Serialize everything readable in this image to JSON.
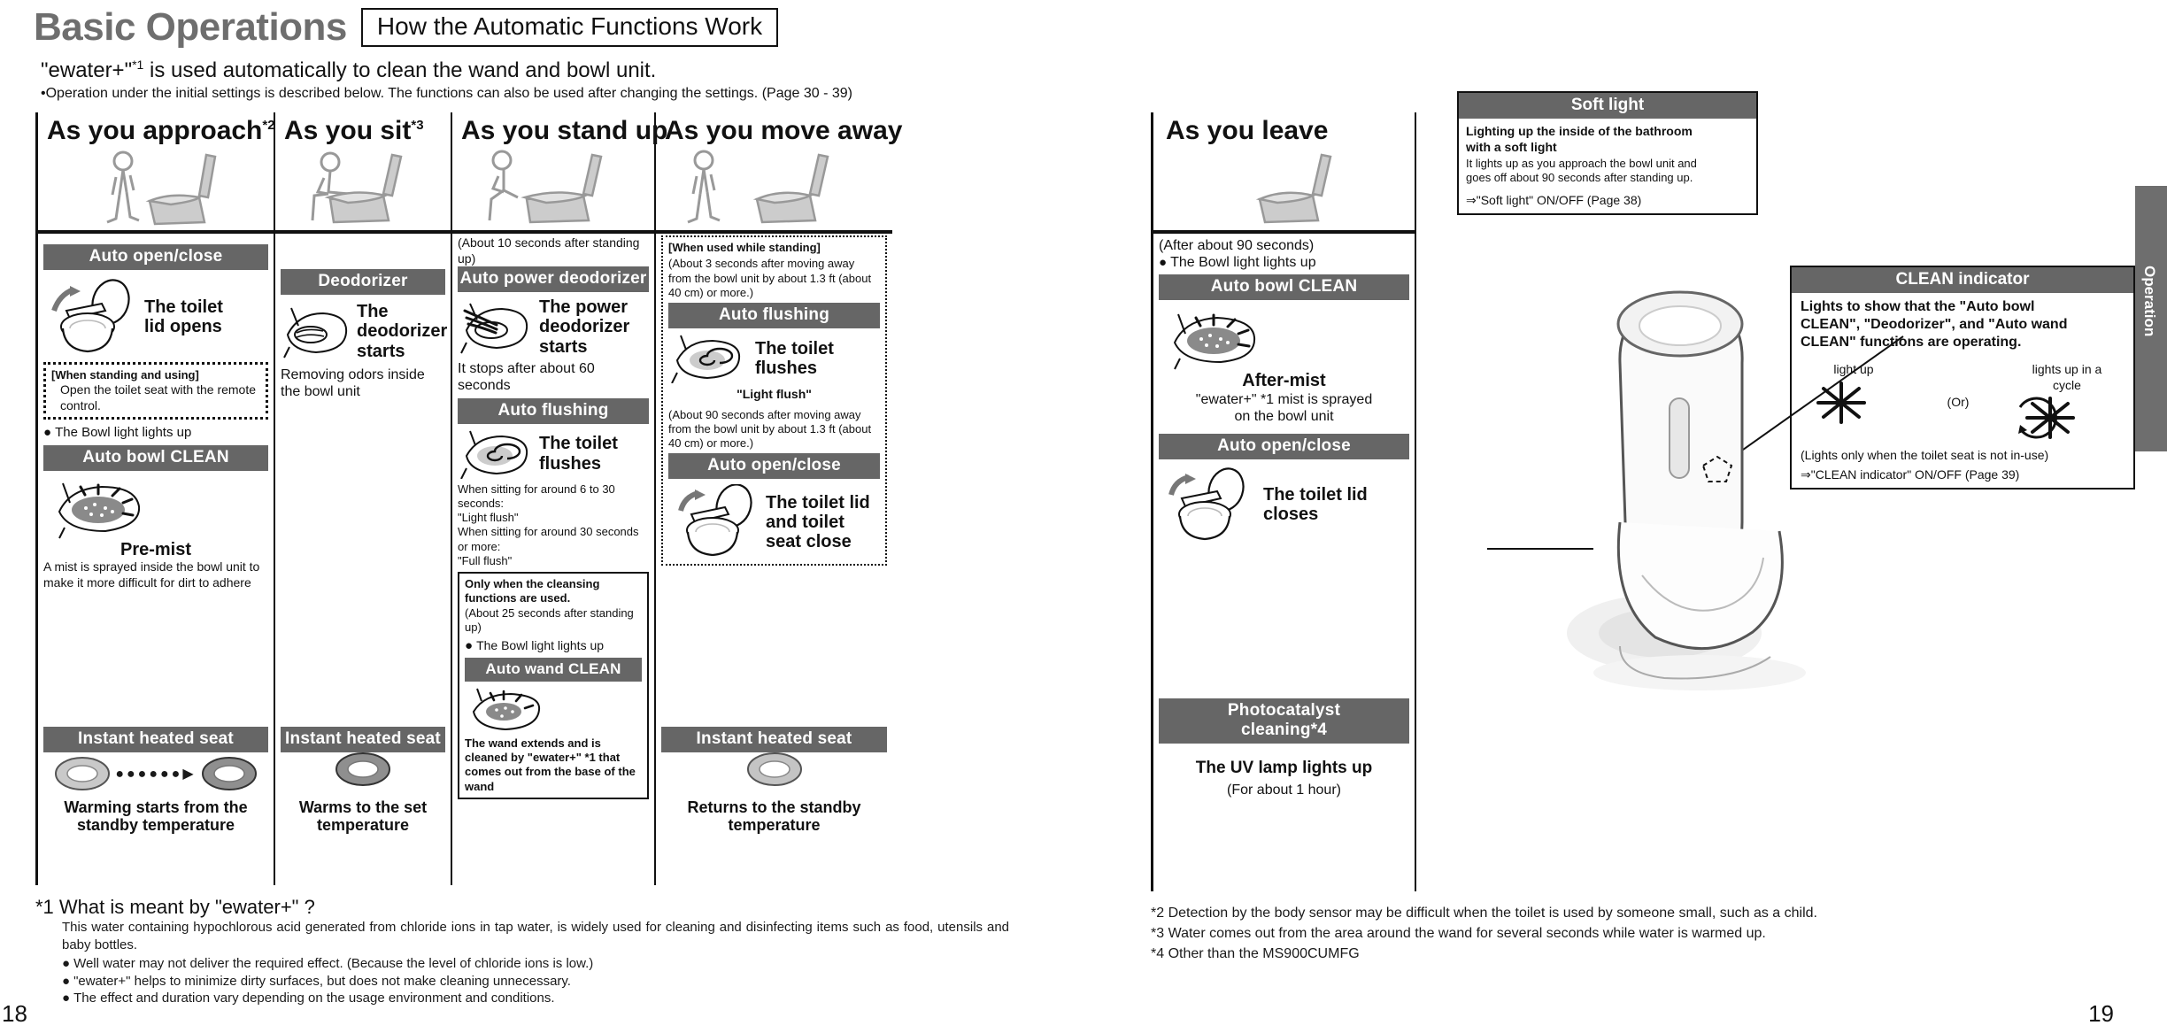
{
  "header": {
    "title": "Basic Operations",
    "subtitle": "How the Automatic Functions Work"
  },
  "lead": {
    "line1_a": "\"ewater+\"",
    "line1_sup": "*1",
    "line1_b": " is used automatically to clean the wand and bowl unit.",
    "line2": "•Operation under the initial settings is described below. The functions can also be used after changing the settings. (Page 30 - 39)"
  },
  "columns": [
    {
      "header": "As you approach",
      "header_sup": "*2",
      "banner1": "Auto open/close",
      "caption1": "The toilet lid opens",
      "note_box_title": "[When standing and using]",
      "note_box_text": "Open the toilet seat with the remote control.",
      "bowl_light": "The Bowl light lights up",
      "banner2": "Auto bowl CLEAN",
      "caption2": "Pre-mist",
      "caption2_desc": "A mist is sprayed inside the bowl unit to make it more difficult for dirt to adhere",
      "banner3": "Instant heated seat",
      "caption3": "Warming starts from the standby temperature"
    },
    {
      "header": "As you sit",
      "header_sup": "*3",
      "banner1": "Deodorizer",
      "caption1": "The deodorizer starts",
      "caption1_desc": "Removing odors inside the bowl unit",
      "banner3": "Instant heated seat",
      "caption3": "Warms to the set temperature"
    },
    {
      "header": "As you stand up",
      "header_sup": "",
      "timing1": "(About 10 seconds after standing up)",
      "banner1": "Auto power deodorizer",
      "caption1": "The power deodorizer starts",
      "caption1_desc": "It stops after about 60 seconds",
      "banner2": "Auto flushing",
      "caption2": "The toilet flushes",
      "caption2_desc_l1": "When sitting for around 6 to 30 seconds:",
      "caption2_desc_l2": "\"Light flush\"",
      "caption2_desc_l3": "When sitting for around 30 seconds or more:",
      "caption2_desc_l4": "\"Full flush\"",
      "cond_box_l1": "Only when the cleansing functions are used.",
      "cond_box_l2": "(About 25 seconds after standing up)",
      "cond_box_l3": "The Bowl light lights up",
      "banner3": "Auto wand CLEAN",
      "caption3_desc": "The wand extends and is cleaned by \"ewater+\" *1 that comes out from the base of the wand"
    },
    {
      "header": "As you move away",
      "header_sup": "",
      "dotted_title": "[When used while standing]",
      "timing1": "(About 3 seconds after moving away from the bowl unit by about 1.3 ft (about 40 cm) or more.)",
      "banner1": "Auto flushing",
      "caption1": "The toilet flushes",
      "caption1_desc": "\"Light flush\"",
      "timing2": "(About 90 seconds after moving away from the bowl unit by about 1.3 ft (about 40 cm) or more.)",
      "banner2": "Auto open/close",
      "caption2": "The toilet lid and toilet seat close",
      "banner3": "Instant heated seat",
      "caption3": "Returns to the standby temperature"
    }
  ],
  "leave": {
    "header": "As you leave",
    "timing": "(After about 90 seconds)",
    "bowl_light": "The Bowl light lights up",
    "banner1": "Auto bowl CLEAN",
    "caption1": "After-mist",
    "caption1_desc_l1": "\"ewater+\" *1 mist is sprayed",
    "caption1_desc_l2": "on the bowl unit",
    "banner2": "Auto open/close",
    "caption2": "The toilet lid closes",
    "banner3_l1": "Photocatalyst",
    "banner3_l2": "cleaning*4",
    "caption3": "The UV lamp lights up",
    "caption3_desc": "(For about 1 hour)"
  },
  "soft_light": {
    "title": "Soft light",
    "bold_l1": "Lighting up the inside of the bathroom",
    "bold_l2": "with a soft light",
    "text_l1": "It lights up as you approach the bowl unit and",
    "text_l2": "goes off about 90 seconds after standing up.",
    "link": "\"Soft light\" ON/OFF (Page 38)"
  },
  "clean_indicator": {
    "title": "CLEAN indicator",
    "bold_l1": "Lights to show that the \"Auto bowl",
    "bold_l2": "CLEAN\", \"Deodorizer\", and \"Auto wand",
    "bold_l3": "CLEAN\" functions are operating.",
    "label_left": "light up",
    "label_right_l1": "lights up in a",
    "label_right_l2": "cycle",
    "or": "(Or)",
    "note": "(Lights only when the toilet seat is not in-use)",
    "link": "\"CLEAN indicator\" ON/OFF (Page 39)"
  },
  "side_tab": {
    "label": "Operation"
  },
  "footnotes_left": {
    "title": "*1 What is meant by \"ewater+\" ?",
    "p1": "This water containing hypochlorous acid generated from chloride ions in tap water, is widely used for cleaning and disinfecting items such as food, utensils and baby bottles.",
    "b1": "Well water may not deliver the required effect. (Because the level of chloride ions is low.)",
    "b2": "\"ewater+\" helps to minimize dirty surfaces, but does not make cleaning unnecessary.",
    "b3": "The effect and duration vary depending on the usage environment and conditions."
  },
  "footnotes_right": {
    "f2": "*2 Detection by the body sensor may be difficult when the toilet is used by someone small, such as a child.",
    "f3": "*3 Water comes out from the area around the wand for several seconds while water is warmed up.",
    "f4": "*4 Other than the MS900CUMFG"
  },
  "page_numbers": {
    "left": "18",
    "right": "19"
  },
  "colors": {
    "banner": "#666666",
    "title": "#6e6e6e",
    "ink": "#111111"
  }
}
